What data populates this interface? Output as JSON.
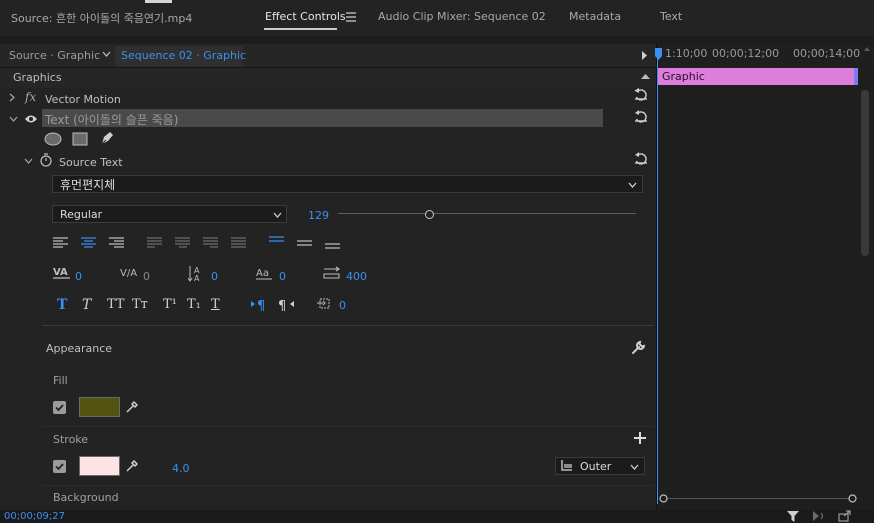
{
  "tabs": [
    {
      "label": "Source: 흔한 아이돌의 죽음연기.mp4",
      "active": false
    },
    {
      "label": "Effect Controls",
      "active": true
    },
    {
      "label": "Audio Clip Mixer: Sequence 02",
      "active": false
    },
    {
      "label": "Metadata",
      "active": false
    },
    {
      "label": "Text",
      "active": false
    }
  ],
  "clip_header": {
    "source": "Source · Graphic",
    "sequence": "Sequence 02 · Graphic"
  },
  "timeline": {
    "ticks": [
      "1:10;00",
      "00;00;12;00",
      "00;00;14;00"
    ],
    "clip_label": "Graphic",
    "clip_color": "#dd7edc",
    "playhead_color": "#3b8ff0"
  },
  "section": {
    "graphics_label": "Graphics"
  },
  "layers": {
    "vector_motion_label": "Vector Motion",
    "fx_label": "fx",
    "text_layer_label": "Text (아이돌의 슬픈 죽음)",
    "source_text_label": "Source Text"
  },
  "font": {
    "family": "휴먼편지체",
    "style": "Regular",
    "size": "129",
    "size_slider_fraction": 0.31
  },
  "metrics": {
    "kerning": "0",
    "tracking": "0",
    "leading": "0",
    "baseline_shift": "0",
    "tsume": "400",
    "tab_width": "0"
  },
  "appearance": {
    "title": "Appearance",
    "fill_label": "Fill",
    "fill_color": "#545412",
    "fill_checked": true,
    "stroke_label": "Stroke",
    "stroke_color": "#fde3e3",
    "stroke_checked": true,
    "stroke_width": "4.0",
    "stroke_position": "Outer",
    "background_label": "Background"
  },
  "status": {
    "timecode": "00;00;09;27"
  }
}
